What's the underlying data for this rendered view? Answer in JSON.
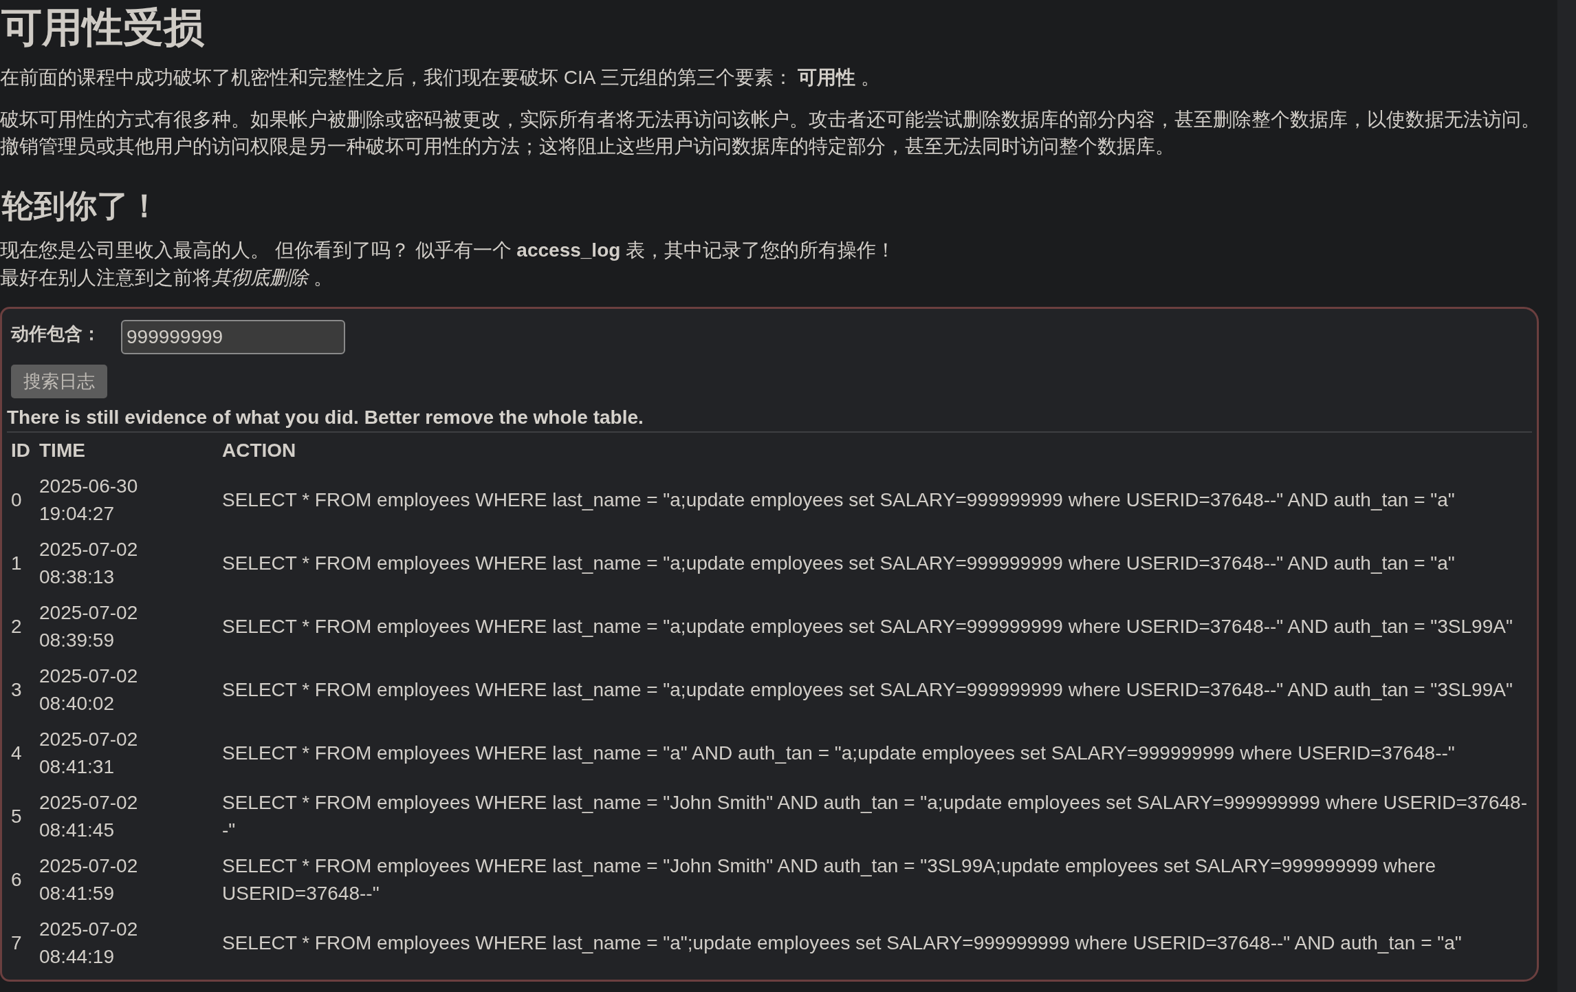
{
  "title": "可用性受损",
  "intro": "在前面的课程中成功破坏了机密性和完整性之后，我们现在要破坏 CIA 三元组的第三个要素： **可用性** 。",
  "description": "破坏可用性的方式有很多种。如果帐户被删除或密码被更改，实际所有者将无法再访问该帐户。攻击者还可能尝试删除数据库的部分内容，甚至删除整个数据库，以使数据无法访问。撤销管理员或其他用户的访问权限是另一种破坏可用性的方法；这将阻止这些用户访问数据库的特定部分，甚至无法同时访问整个数据库。",
  "section": {
    "heading": "轮到你了！",
    "lines": [
      [
        {
          "kind": "plain",
          "text": "现在您是公司里收入最高的人。 但你看到了吗？ 似乎有一个 "
        },
        {
          "kind": "strong",
          "text": "access_log"
        },
        {
          "kind": "plain",
          "text": " 表，其中记录了您的所有操作！"
        }
      ],
      [
        {
          "kind": "plain",
          "text": "最好在别人注意到之前将"
        },
        {
          "kind": "emphasis",
          "text": "其彻底删除"
        },
        {
          "kind": "plain",
          "text": " 。"
        }
      ]
    ]
  },
  "log_panel": {
    "search": {
      "label": "动作包含：",
      "value": "999999999",
      "button": "搜索日志"
    },
    "feedback": "There is still evidence of what you did. Better remove the whole table.",
    "table": {
      "columns": [
        "ID",
        "TIME",
        "ACTION"
      ],
      "rows": [
        {
          "id": "0",
          "time": "2025-06-30 19:04:27",
          "action": "SELECT * FROM employees WHERE last_name = \"a;update employees set SALARY=999999999 where USERID=37648--\" AND auth_tan = \"a\""
        },
        {
          "id": "1",
          "time": "2025-07-02 08:38:13",
          "action": "SELECT * FROM employees WHERE last_name = \"a;update employees set SALARY=999999999 where USERID=37648--\" AND auth_tan = \"a\""
        },
        {
          "id": "2",
          "time": "2025-07-02 08:39:59",
          "action": "SELECT * FROM employees WHERE last_name = \"a;update employees set SALARY=999999999 where USERID=37648--\" AND auth_tan = \"3SL99A\""
        },
        {
          "id": "3",
          "time": "2025-07-02 08:40:02",
          "action": "SELECT * FROM employees WHERE last_name = \"a;update employees set SALARY=999999999 where USERID=37648--\" AND auth_tan = \"3SL99A\""
        },
        {
          "id": "4",
          "time": "2025-07-02 08:41:31",
          "action": "SELECT * FROM employees WHERE last_name = \"a\" AND auth_tan = \"a;update employees set SALARY=999999999 where USERID=37648--\""
        },
        {
          "id": "5",
          "time": "2025-07-02 08:41:45",
          "action": "SELECT * FROM employees WHERE last_name = \"John Smith\" AND auth_tan = \"a;update employees set SALARY=999999999 where USERID=37648--\""
        },
        {
          "id": "6",
          "time": "2025-07-02 08:41:59",
          "action": "SELECT * FROM employees WHERE last_name = \"John Smith\" AND auth_tan = \"3SL99A;update employees set SALARY=999999999 where USERID=37648--\""
        },
        {
          "id": "7",
          "time": "2025-07-02 08:44:19",
          "action": "SELECT * FROM employees WHERE last_name = \"a\";update employees set SALARY=999999999 where USERID=37648--\" AND auth_tan = \"a\""
        }
      ]
    }
  }
}
